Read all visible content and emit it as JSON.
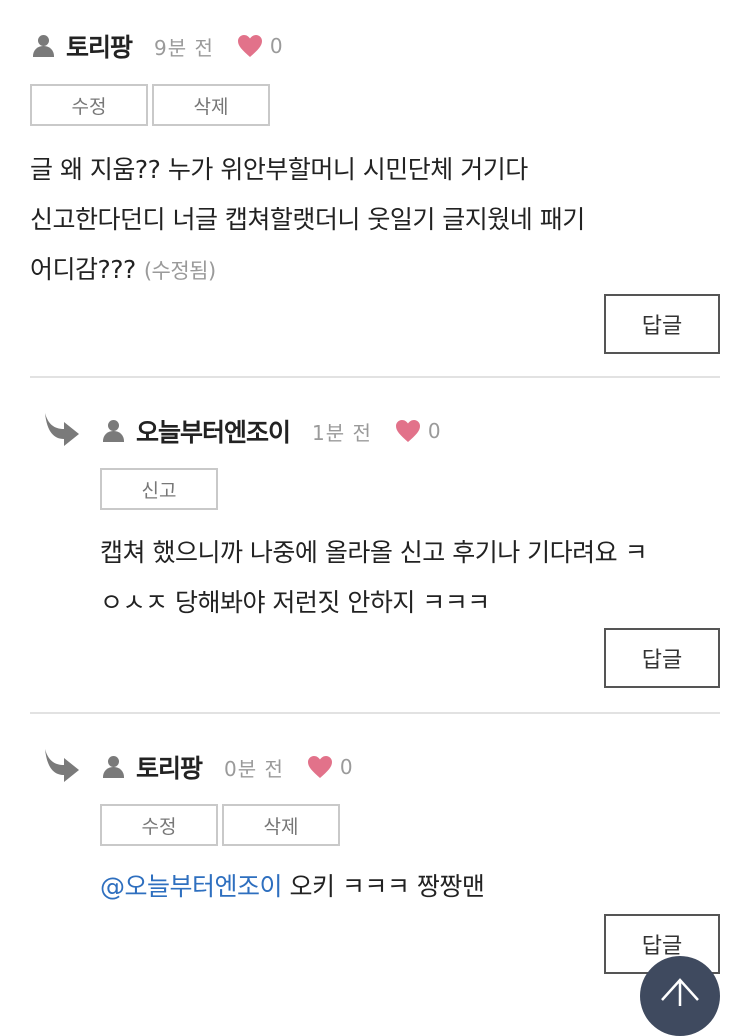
{
  "comments": [
    {
      "nick": "토리팡",
      "time": "9분 전",
      "likes": "0",
      "buttons": [
        "수정",
        "삭제"
      ],
      "lines": [
        "글 왜 지움?? 누가 위안부할머니 시민단체 거기다",
        "신고한다던디 너글 캡쳐할랫더니 웃일기 글지웠네 패기",
        "어디감???"
      ],
      "edited": "(수정됨)",
      "reply_label": "답글"
    },
    {
      "nick": "오늘부터엔조이",
      "time": "1분 전",
      "likes": "0",
      "buttons": [
        "신고"
      ],
      "lines": [
        "캡쳐 했으니까 나중에 올라올 신고 후기나 기다려요 ㅋ",
        "ㅇㅅㅈ 당해봐야 저런짓 안하지 ㅋㅋㅋ"
      ],
      "reply_label": "답글"
    },
    {
      "nick": "토리팡",
      "time": "0분 전",
      "likes": "0",
      "buttons": [
        "수정",
        "삭제"
      ],
      "mention": "@오늘부터엔조이",
      "text": " 오키 ㅋㅋㅋ 짱짱맨",
      "reply_label": "답글"
    }
  ],
  "colors": {
    "heart": "#e2728a",
    "mention": "#2e6fbf",
    "top_button": "#3f4a5f"
  },
  "icons": [
    "person-icon",
    "heart-icon",
    "reply-arrow-icon",
    "arrow-up-icon"
  ]
}
